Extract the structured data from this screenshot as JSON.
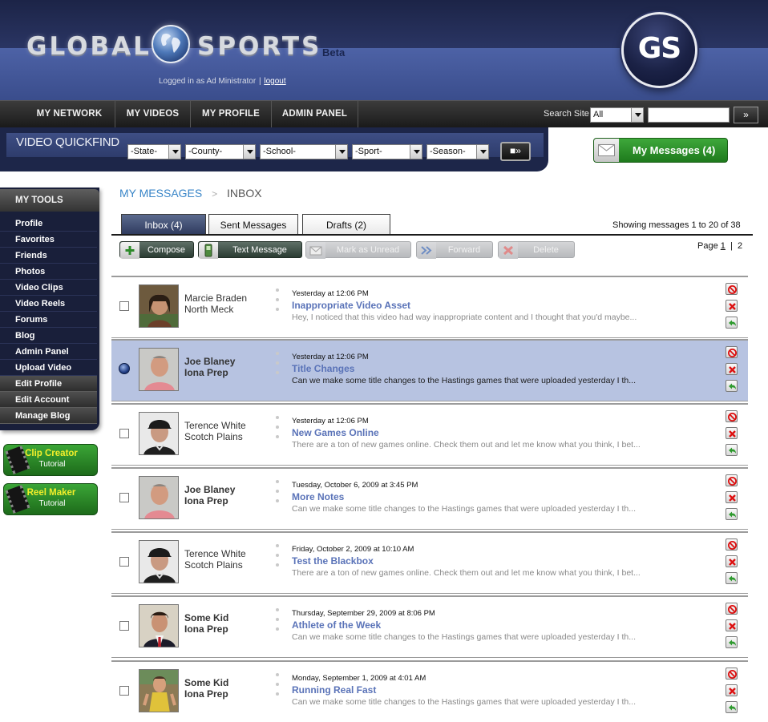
{
  "header": {
    "brand_left": "GLOBAL",
    "brand_right": "SPORTS",
    "beta": "Beta",
    "login_text": "Logged in as Ad Ministrator",
    "logout": "logout",
    "badge": "GS"
  },
  "nav": {
    "items": [
      "MY NETWORK",
      "MY VIDEOS",
      "MY PROFILE",
      "ADMIN PANEL"
    ],
    "search_label": "Search Site",
    "search_scope": "All",
    "search_go": "»"
  },
  "quickfind": {
    "label": "VIDEO QUICKFIND",
    "filters": [
      "-State-",
      "-County-",
      "-School-",
      "-Sport-",
      "-Season-"
    ],
    "go": "»"
  },
  "my_messages": {
    "label": "My Messages (4)"
  },
  "sidebar": {
    "title": "MY TOOLS",
    "items": [
      "Profile",
      "Favorites",
      "Friends",
      "Photos",
      "Video Clips",
      "Video Reels",
      "Forums",
      "Blog",
      "Admin Panel",
      "Upload Video"
    ],
    "grey_items": [
      "Edit Profile",
      "Edit Account",
      "Manage Blog"
    ],
    "tutorials": [
      {
        "title": "Clip Creator",
        "sub": "Tutorial"
      },
      {
        "title": "Reel Maker",
        "sub": "Tutorial"
      }
    ]
  },
  "breadcrumb": {
    "parent": "MY MESSAGES",
    "separator": ">",
    "current": "INBOX"
  },
  "tabs": [
    "Inbox (4)",
    "Sent Messages",
    "Drafts (2)"
  ],
  "showing": "Showing messages 1 to 20  of 38",
  "toolbar": {
    "compose": "Compose",
    "text_message": "Text Message",
    "mark_unread": "Mark as Unread",
    "forward": "Forward",
    "delete": "Delete"
  },
  "pager": {
    "label": "Page",
    "current": "1",
    "separator": "|",
    "next": "2"
  },
  "messages": [
    {
      "name": "Marcie Braden",
      "school": "North Meck",
      "date": "Yesterday at 12:06 PM",
      "subject": "Inappropriate Video Asset",
      "preview": "Hey, I noticed that this video had way inappropriate content and I thought that you'd maybe..."
    },
    {
      "name": "Joe Blaney",
      "school": "Iona Prep",
      "date": "Yesterday at 12:06 PM",
      "subject": "Title Changes",
      "preview": "Can we make some title changes to the Hastings games that were uploaded yesterday I th..."
    },
    {
      "name": "Terence White",
      "school": "Scotch Plains",
      "date": "Yesterday at 12:06 PM",
      "subject": "New Games Online",
      "preview": "There are a ton of new games online. Check them out and let me know what you think, I bet..."
    },
    {
      "name": "Joe Blaney",
      "school": "Iona Prep",
      "date": "Tuesday, October 6, 2009 at 3:45 PM",
      "subject": "More Notes",
      "preview": "Can we make some title changes to the Hastings games that were uploaded yesterday I th..."
    },
    {
      "name": "Terence White",
      "school": "Scotch Plains",
      "date": "Friday, October 2, 2009 at 10:10 AM",
      "subject": "Test the Blackbox",
      "preview": "There are a ton of new games online. Check them out and let me know what you think, I bet..."
    },
    {
      "name": "Some Kid",
      "school": "Iona Prep",
      "date": "Thursday, September 29, 2009 at 8:06 PM",
      "subject": "Athlete of the Week",
      "preview": "Can we make some title changes to the Hastings games that were uploaded yesterday I th..."
    },
    {
      "name": "Some Kid",
      "school": "Iona Prep",
      "date": "Monday, September 1, 2009 at 4:01 AM",
      "subject": "Running Real Fast",
      "preview": "Can we make some title changes to the Hastings games that were uploaded yesterday I th..."
    }
  ]
}
